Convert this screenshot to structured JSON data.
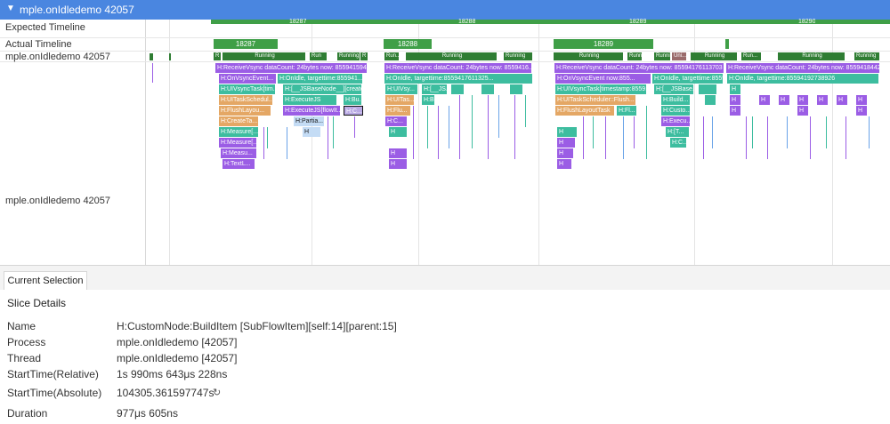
{
  "header": {
    "title": "mple.onIdledemo 42057"
  },
  "rows": {
    "expected": "Expected Timeline",
    "actual": "Actual Timeline",
    "thread_state": "mple.onIdledemo 42057",
    "thread_calls": "mple.onIdledemo 42057"
  },
  "expected_frames": [
    "18287",
    "18288",
    "18289",
    "18290"
  ],
  "actual_frames": [
    "18287",
    "18288",
    "18289"
  ],
  "state_labels": {
    "running": "Running",
    "r": "R",
    "run": "Run...",
    "run2": "Run",
    "runn": "Runn",
    "runni": "Runni",
    "uni": "Uni..."
  },
  "slices": {
    "vsync1": "H:ReceiveVsync dataCount: 24bytes now: 8559415948...",
    "vsync2": "H:ReceiveVsync dataCount: 24bytes now: 8559416...",
    "vsync3": "H:ReceiveVsync dataCount: 24bytes now: 85594176113703 ...",
    "vsync4": "H:ReceiveVsync dataCount: 24bytes now: 85594184427...",
    "onvsync1": "H:OnVsyncEvent...",
    "onidle1": "H:OnIdle, targettime:855941...",
    "onidle2": "H:OnIdle, targettime:8559417611325...",
    "onvsync3": "H:OnVsyncEvent now:855...",
    "onidle3": "H:OnIdle, targettime:855941...",
    "onidle4": "H:OnIdle, targettime:85594192738926",
    "uivsync1": "H:UIVsyncTask[tim...",
    "jsbase1": "H:[__JSBaseNode__][create]",
    "uivsync2": "H:UIVsy...",
    "js2": "H:[__JS...",
    "uivsync3": "H:UIVsyncTask[timestamp:8559...",
    "jsbase3": "H:[__JSBase...",
    "uitask1": "H:UITaskSchedul...",
    "execjs1": "H:ExecuteJS",
    "bu1": "H:Bu...",
    "uitas2": "H:UITas...",
    "b2": "H:B...",
    "uitask3": "H:UITaskScheduler::Flush...",
    "build3": "H:Build...",
    "flushlay1": "H:FlushLayou...",
    "execflow1": "H:ExecuteJS[flowIt...",
    "c1": "H:C...",
    "flu2": "H:Flu...",
    "flushlay3": "H:FlushLayoutTask",
    "fl3": "H:Fl...",
    "custo3": "H:Custo...",
    "createta": "H:CreateTa...",
    "partia": "H:Partia...",
    "c2": "H:C...",
    "execu3": "H:Execu...",
    "measure1": "H:Measure[...",
    "measure2": "H:Measure[...",
    "measu3": "H:Measu...",
    "textl": "H:TextL...",
    "h": "H",
    "t3": "H:[T...",
    "c3": "H:C..."
  },
  "tab": {
    "label": "Current Selection"
  },
  "details": {
    "title": "Slice Details",
    "labels": [
      "Name",
      "Process",
      "Thread",
      "StartTime(Relative)",
      "StartTime(Absolute)",
      "Duration"
    ],
    "values": [
      "H:CustomNode:BuildItem [SubFlowItem][self:14][parent:15]",
      "mple.onIdledemo [42057]",
      "mple.onIdledemo [42057]",
      "1s 990ms 643μs 228ns",
      "104305.361597747s",
      "977μs 605ns"
    ]
  },
  "colors": {
    "header": "#4a86e0",
    "frame_green": "#3f9f47",
    "running_green": "#2f7d33",
    "purple": "#9b5de5",
    "teal": "#3dbd9f",
    "orange": "#e4a765",
    "blue": "#6aa3e8",
    "lavender": "#b9a9e4"
  }
}
